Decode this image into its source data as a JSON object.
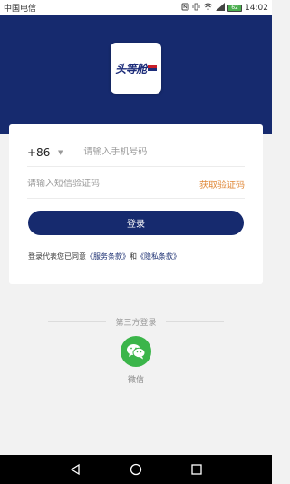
{
  "status_bar": {
    "carrier": "中国电信",
    "time": "14:02",
    "battery": "62"
  },
  "logo": {
    "text": "头等舱"
  },
  "login": {
    "country_code": "+86",
    "phone_placeholder": "请输入手机号码",
    "code_placeholder": "请输入短信验证码",
    "get_code_label": "获取验证码",
    "login_button_label": "登录",
    "terms_prefix": "登录代表您已同意",
    "terms_service": "《服务条款》",
    "terms_and": "和",
    "terms_privacy": "《隐私条款》"
  },
  "third_party": {
    "title": "第三方登录",
    "wechat_label": "微信"
  },
  "colors": {
    "brand_navy": "#162a6e",
    "accent_orange": "#e0893a",
    "wechat_green": "#3bb54a"
  },
  "icons": [
    "nfc-icon",
    "vibrate-icon",
    "wifi-icon",
    "signal-icon",
    "battery-icon",
    "wechat-icon",
    "back-icon",
    "home-icon",
    "recents-icon"
  ]
}
